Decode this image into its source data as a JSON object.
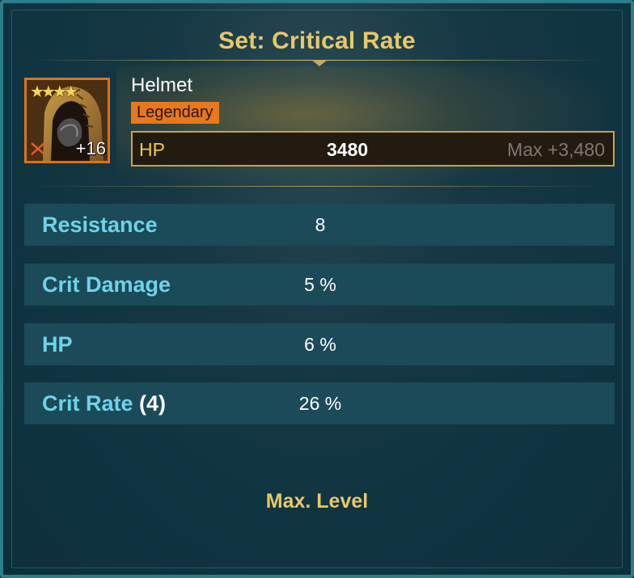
{
  "set_title": "Set: Critical Rate",
  "item": {
    "stars": "★★★★",
    "star_count": 4,
    "level": "+16",
    "name": "Helmet",
    "rarity": "Legendary",
    "icon": "helmet-icon",
    "faction_icon": "crossed-swords-icon"
  },
  "main_stat": {
    "name": "HP",
    "value": "3480",
    "max": "Max +3,480"
  },
  "substats": [
    {
      "name": "Resistance",
      "count": "",
      "value": "8"
    },
    {
      "name": "Crit Damage",
      "count": "",
      "value": "5 %"
    },
    {
      "name": "HP",
      "count": "",
      "value": "6 %"
    },
    {
      "name": "Crit Rate",
      "count": "(4)",
      "value": "26 %"
    }
  ],
  "footer": "Max. Level",
  "colors": {
    "gold": "#e7c86a",
    "rarity_orange": "#e8781c",
    "substat_name": "#6fd3ea",
    "substat_row": "#1b4a59"
  }
}
